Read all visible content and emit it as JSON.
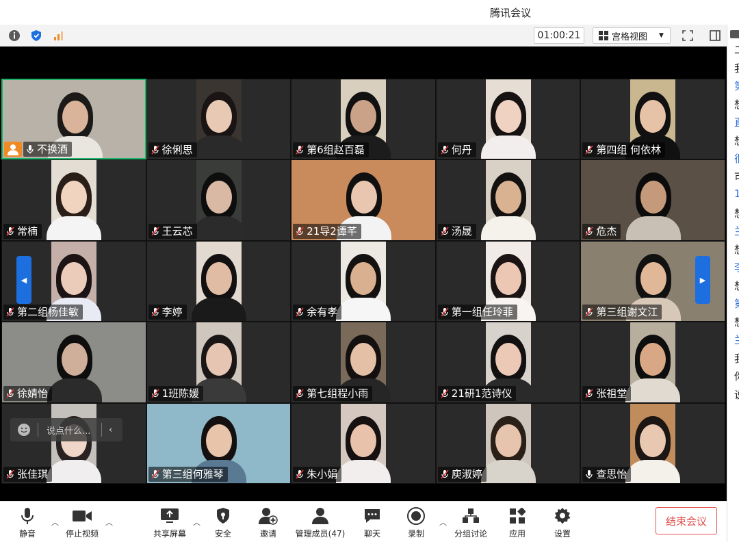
{
  "window": {
    "title": "腾讯会议"
  },
  "toolbar": {
    "timer": "01:00:21",
    "view_label": "宫格视图"
  },
  "participants": [
    {
      "name": "不换酒",
      "muted": false,
      "host": true,
      "bg": "#b8b2a8",
      "skin": "#d9b49a",
      "hair": "#1b1a18",
      "shirt": "#e9e6df"
    },
    {
      "name": "徐俐思",
      "muted": true,
      "bg": "#3a3530",
      "skin": "#e8c9b4",
      "hair": "#1a1414",
      "shirt": "#2a2a2a"
    },
    {
      "name": "第6组赵百磊",
      "muted": true,
      "bg": "#d8cfbf",
      "skin": "#caa288",
      "hair": "#111",
      "shirt": "#1c1c1c"
    },
    {
      "name": "何丹",
      "muted": true,
      "bg": "#e6ddd5",
      "skin": "#f0d2c2",
      "hair": "#161212",
      "shirt": "#f2eeee"
    },
    {
      "name": "第四组 何依林",
      "muted": true,
      "bg": "#c9b78f",
      "skin": "#e6c2a6",
      "hair": "#121010",
      "shirt": "#111"
    },
    {
      "name": "常楠",
      "muted": true,
      "bg": "#e4ddd3",
      "skin": "#f0d4c0",
      "hair": "#2a1f18",
      "shirt": "#f4f4f4"
    },
    {
      "name": "王云芯",
      "muted": true,
      "bg": "#3a3c3a",
      "skin": "#d9b8a4",
      "hair": "#0e0e0e",
      "shirt": "#2b2b2b"
    },
    {
      "name": "21导2谭芊",
      "muted": true,
      "bg": "#c98a5c",
      "skin": "#e8c6b0",
      "hair": "#101010",
      "shirt": "#f3f3f3"
    },
    {
      "name": "汤晟",
      "muted": true,
      "bg": "#d9d1c5",
      "skin": "#d8b291",
      "hair": "#141210",
      "shirt": "#f4f2ea"
    },
    {
      "name": "危杰",
      "muted": true,
      "bg": "#5a5046",
      "skin": "#c49a7a",
      "hair": "#0c0c0c",
      "shirt": "#c8c0b5"
    },
    {
      "name": "第二组杨佳敏",
      "muted": true,
      "bg": "#c4b0a8",
      "skin": "#ebcbb9",
      "hair": "#1c1414",
      "shirt": "#e8eaf4"
    },
    {
      "name": "李婷",
      "muted": true,
      "bg": "#e2dad0",
      "skin": "#e0bca4",
      "hair": "#121010",
      "shirt": "#1a1a1a"
    },
    {
      "name": "余有孝",
      "muted": true,
      "bg": "#ece8e2",
      "skin": "#d9b090",
      "hair": "#141210",
      "shirt": "#f6f6f6"
    },
    {
      "name": "第一组任玲菲",
      "muted": true,
      "bg": "#f0ebe6",
      "skin": "#ecc8b4",
      "hair": "#1a1414",
      "shirt": "#f8f4f2"
    },
    {
      "name": "第三组谢文江",
      "muted": true,
      "bg": "#8a8070",
      "skin": "#e0b898",
      "hair": "#111",
      "shirt": "#d8c8b8"
    },
    {
      "name": "徐婧怡",
      "muted": true,
      "bg": "#8c8c88",
      "skin": "#cfae9a",
      "hair": "#0e0e0e",
      "shirt": "#2b2b2b"
    },
    {
      "name": "1班陈媛",
      "muted": true,
      "bg": "#cfc7bd",
      "skin": "#e6c6b2",
      "hair": "#1a1616",
      "shirt": "#3a3a3a"
    },
    {
      "name": "第七组程小雨",
      "muted": true,
      "bg": "#7a6a5a",
      "skin": "#e4c0a6",
      "hair": "#141010",
      "shirt": "#262626"
    },
    {
      "name": "21研1范诗仪",
      "muted": true,
      "bg": "#d8d2cc",
      "skin": "#ecc8b6",
      "hair": "#121010",
      "shirt": "#2a2a2a"
    },
    {
      "name": "张祖堂",
      "muted": true,
      "bg": "#b8ae9e",
      "skin": "#d8a886",
      "hair": "#0e0e0e",
      "shirt": "#e0dad0"
    },
    {
      "name": "张佳琪",
      "muted": true,
      "bg": "#c4c0bc",
      "skin": "#f0d6c8",
      "hair": "#2a2222",
      "shirt": "#f0eeee"
    },
    {
      "name": "第三组何雅琴",
      "muted": true,
      "bg": "#8fb8c8",
      "skin": "#e8c4aa",
      "hair": "#141010",
      "shirt": "#5a7a94"
    },
    {
      "name": "朱小娟",
      "muted": true,
      "bg": "#d4c8c0",
      "skin": "#e8c2aa",
      "hair": "#161010",
      "shirt": "#f2eeee"
    },
    {
      "name": "庾淑婷",
      "muted": true,
      "bg": "#cec6bc",
      "skin": "#e6c4ae",
      "hair": "#2a2018",
      "shirt": "#d8d4cc"
    },
    {
      "name": "查思怡",
      "muted": false,
      "bg": "#c08c5c",
      "skin": "#e8c8b0",
      "hair": "#1c1614",
      "shirt": "#f4f0ea"
    }
  ],
  "chat_float": {
    "placeholder": "说点什么..."
  },
  "bottombar": {
    "mute": "静音",
    "stop_video": "停止视频",
    "share_screen": "共享屏幕",
    "security": "安全",
    "invite": "邀请",
    "manage_members": "管理成员(47)",
    "chat": "聊天",
    "record": "录制",
    "breakout": "分组讨论",
    "apps": "应用",
    "settings": "设置",
    "end_meeting": "结束会议"
  },
  "side_chars": [
    "二",
    "我",
    "第",
    "想",
    "直",
    "想",
    "很",
    "可",
    "1",
    "想",
    "兰",
    "想",
    "李",
    "想",
    "第",
    "想",
    "兰",
    "我",
    "你",
    "说"
  ]
}
